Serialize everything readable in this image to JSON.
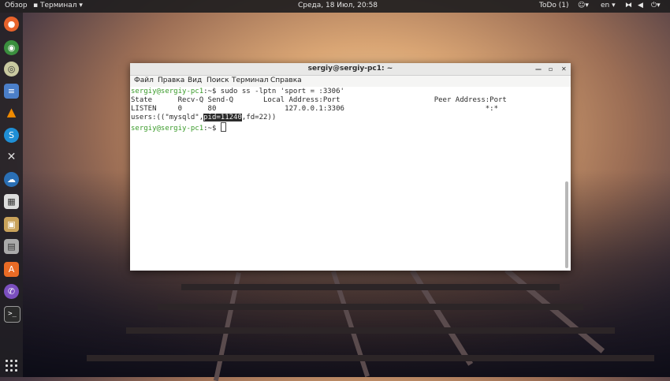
{
  "topbar": {
    "overview": "Обзор",
    "app_menu": "Терминал",
    "clock": "Среда, 18 Июл, 20:58",
    "todo": "ToDo (1)",
    "lang": "en"
  },
  "window": {
    "title": "sergiy@sergiy-pc1: ~",
    "menu": [
      "Файл",
      "Правка",
      "Вид",
      "Поиск",
      "Терминал",
      "Справка"
    ]
  },
  "terminal": {
    "prompt": "sergiy@sergiy-pc1",
    "line1_cmd": ":~$ sudo ss -lptn 'sport = :3306'",
    "line2": "State      Recv-Q Send-Q       Local Address:Port                      Peer Address:Port",
    "line3": "LISTEN     0      80                127.0.0.1:3306                                 *:*",
    "line4_pre": "users:((\"mysqld\",",
    "line4_sel": "pid=11240",
    "line4_post": ",fd=22))",
    "line5_cmd": ":~$ "
  },
  "colors": {
    "prompt": "#3a9b2a",
    "selection": "#2b2b2b"
  }
}
